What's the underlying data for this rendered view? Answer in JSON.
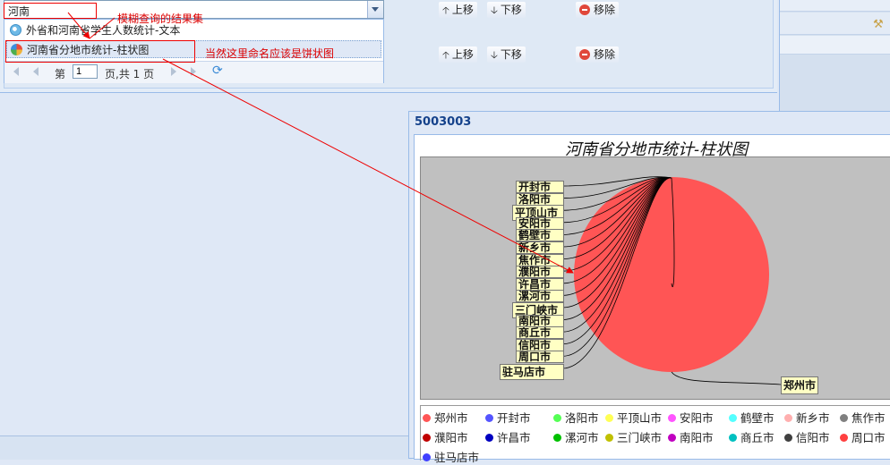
{
  "search": {
    "value": "河南"
  },
  "results": [
    {
      "label": "外省和河南省学生人数统计-文本",
      "icon": "globe-icon"
    },
    {
      "label": "河南省分地市统计-柱状图",
      "icon": "pie-chart-icon"
    }
  ],
  "pager": {
    "page_prefix": "第",
    "page": "1",
    "page_suffix": "页,共 1 页"
  },
  "rows": [
    {
      "up": "上移",
      "down": "下移",
      "remove": "移除"
    },
    {
      "up": "上移",
      "down": "下移",
      "remove": "移除"
    }
  ],
  "annotations": {
    "fuzzy": "模糊查询的结果集",
    "naming": "当然这里命名应该是饼状图"
  },
  "chart_window": {
    "title": "5003003"
  },
  "chart_data": {
    "type": "pie",
    "title": "河南省分地市统计-柱状图",
    "categories": [
      "郑州市",
      "开封市",
      "洛阳市",
      "平顶山市",
      "安阳市",
      "鹤壁市",
      "新乡市",
      "焦作市",
      "濮阳市",
      "许昌市",
      "漯河市",
      "三门峡市",
      "南阳市",
      "商丘市",
      "信阳市",
      "周口市",
      "驻马店市"
    ],
    "values": [
      100,
      0,
      0,
      0,
      0,
      0,
      0,
      0,
      0,
      0,
      0,
      0,
      0,
      0,
      0,
      0,
      0
    ],
    "colors": [
      "#ff5555",
      "#5555ff",
      "#55ff55",
      "#ffff55",
      "#ff55ff",
      "#55ffff",
      "#ffafaf",
      "#808080",
      "#c00000",
      "#0000c0",
      "#00c000",
      "#c0c000",
      "#c000c0",
      "#00c0c0",
      "#404040",
      "#ff4040",
      "#4040ff"
    ],
    "legend_position": "bottom"
  }
}
